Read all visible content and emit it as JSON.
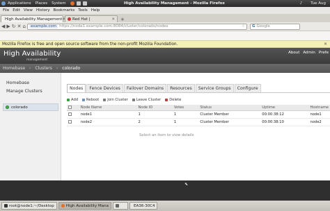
{
  "gnome_panel": {
    "menus": [
      "Applications",
      "Places",
      "System"
    ],
    "window_title": "High Availability Management - Mozilla Firefox",
    "clock": "Tue Aug"
  },
  "firefox": {
    "menu": [
      "File",
      "Edit",
      "View",
      "History",
      "Bookmarks",
      "Tools",
      "Help"
    ],
    "tabs": [
      {
        "label": "High Availability Management",
        "active": true
      },
      {
        "label": "Red Hat |",
        "active": false
      }
    ],
    "url_site": "example.com",
    "url_path": "https://node1.example.com:8084/cluster/colorado/nodes",
    "search_placeholder": "Google",
    "notice": "Mozilla Firefox is free and open source software from the non-profit Mozilla Foundation."
  },
  "app": {
    "brand": "High Availability",
    "sub": "management",
    "header_links": [
      "About",
      "Admin",
      "Prefe"
    ],
    "breadcrumb": [
      "Homebase",
      "Clusters",
      "colorado"
    ]
  },
  "sidebar": {
    "links": [
      "Homebase",
      "Manage Clusters"
    ],
    "cluster": "colorado"
  },
  "tabs": [
    "Nodes",
    "Fence Devices",
    "Failover Domains",
    "Resources",
    "Service Groups",
    "Configure"
  ],
  "toolbar": [
    "Add",
    "Reboot",
    "Join Cluster",
    "Leave Cluster",
    "Delete"
  ],
  "table": {
    "headers": [
      "Node Name",
      "Node ID",
      "Votes",
      "Status",
      "Uptime",
      "Hostname"
    ],
    "rows": [
      [
        "node1",
        "1",
        "1",
        "Cluster Member",
        "00:00:38:12",
        "node1"
      ],
      [
        "node2",
        "2",
        "1",
        "Cluster Member",
        "00:00:38:10",
        "node2"
      ]
    ],
    "hint": "Select an item to view details"
  },
  "taskbar": [
    {
      "label": "root@node1:~/Desktop",
      "active": false
    },
    {
      "label": "High Availability Mana",
      "active": true
    },
    {
      "label": "",
      "active": false
    },
    {
      "label": "EA36-30C4",
      "active": false
    }
  ]
}
